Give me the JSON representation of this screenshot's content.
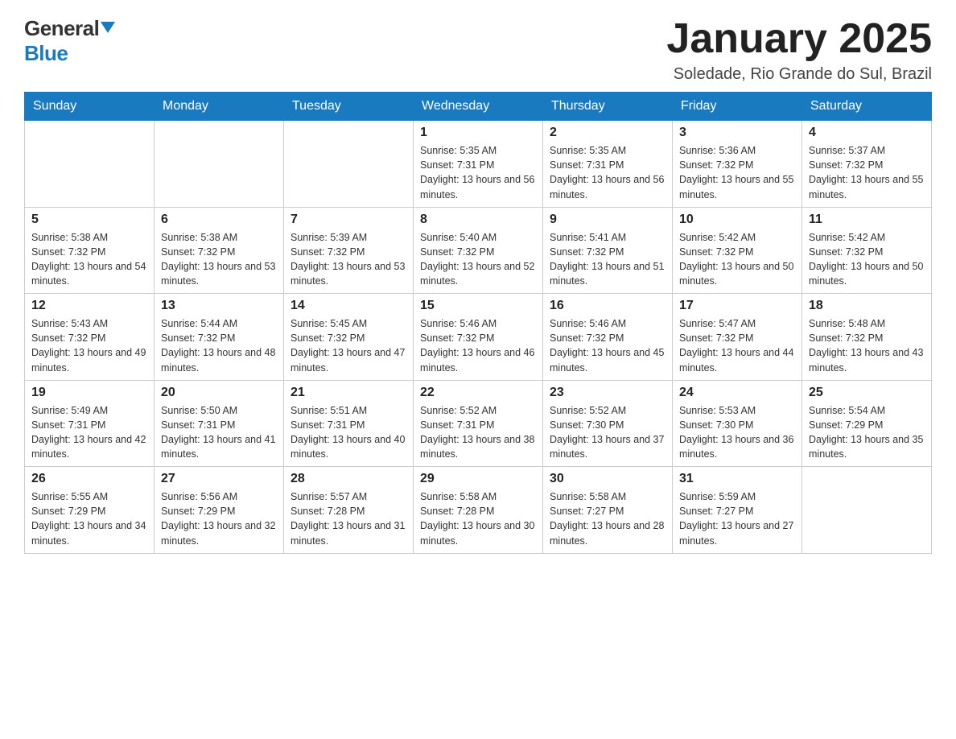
{
  "header": {
    "logo_general": "General",
    "logo_blue": "Blue",
    "month_title": "January 2025",
    "location": "Soledade, Rio Grande do Sul, Brazil"
  },
  "days_of_week": [
    "Sunday",
    "Monday",
    "Tuesday",
    "Wednesday",
    "Thursday",
    "Friday",
    "Saturday"
  ],
  "weeks": [
    [
      {
        "day": "",
        "info": ""
      },
      {
        "day": "",
        "info": ""
      },
      {
        "day": "",
        "info": ""
      },
      {
        "day": "1",
        "info": "Sunrise: 5:35 AM\nSunset: 7:31 PM\nDaylight: 13 hours and 56 minutes."
      },
      {
        "day": "2",
        "info": "Sunrise: 5:35 AM\nSunset: 7:31 PM\nDaylight: 13 hours and 56 minutes."
      },
      {
        "day": "3",
        "info": "Sunrise: 5:36 AM\nSunset: 7:32 PM\nDaylight: 13 hours and 55 minutes."
      },
      {
        "day": "4",
        "info": "Sunrise: 5:37 AM\nSunset: 7:32 PM\nDaylight: 13 hours and 55 minutes."
      }
    ],
    [
      {
        "day": "5",
        "info": "Sunrise: 5:38 AM\nSunset: 7:32 PM\nDaylight: 13 hours and 54 minutes."
      },
      {
        "day": "6",
        "info": "Sunrise: 5:38 AM\nSunset: 7:32 PM\nDaylight: 13 hours and 53 minutes."
      },
      {
        "day": "7",
        "info": "Sunrise: 5:39 AM\nSunset: 7:32 PM\nDaylight: 13 hours and 53 minutes."
      },
      {
        "day": "8",
        "info": "Sunrise: 5:40 AM\nSunset: 7:32 PM\nDaylight: 13 hours and 52 minutes."
      },
      {
        "day": "9",
        "info": "Sunrise: 5:41 AM\nSunset: 7:32 PM\nDaylight: 13 hours and 51 minutes."
      },
      {
        "day": "10",
        "info": "Sunrise: 5:42 AM\nSunset: 7:32 PM\nDaylight: 13 hours and 50 minutes."
      },
      {
        "day": "11",
        "info": "Sunrise: 5:42 AM\nSunset: 7:32 PM\nDaylight: 13 hours and 50 minutes."
      }
    ],
    [
      {
        "day": "12",
        "info": "Sunrise: 5:43 AM\nSunset: 7:32 PM\nDaylight: 13 hours and 49 minutes."
      },
      {
        "day": "13",
        "info": "Sunrise: 5:44 AM\nSunset: 7:32 PM\nDaylight: 13 hours and 48 minutes."
      },
      {
        "day": "14",
        "info": "Sunrise: 5:45 AM\nSunset: 7:32 PM\nDaylight: 13 hours and 47 minutes."
      },
      {
        "day": "15",
        "info": "Sunrise: 5:46 AM\nSunset: 7:32 PM\nDaylight: 13 hours and 46 minutes."
      },
      {
        "day": "16",
        "info": "Sunrise: 5:46 AM\nSunset: 7:32 PM\nDaylight: 13 hours and 45 minutes."
      },
      {
        "day": "17",
        "info": "Sunrise: 5:47 AM\nSunset: 7:32 PM\nDaylight: 13 hours and 44 minutes."
      },
      {
        "day": "18",
        "info": "Sunrise: 5:48 AM\nSunset: 7:32 PM\nDaylight: 13 hours and 43 minutes."
      }
    ],
    [
      {
        "day": "19",
        "info": "Sunrise: 5:49 AM\nSunset: 7:31 PM\nDaylight: 13 hours and 42 minutes."
      },
      {
        "day": "20",
        "info": "Sunrise: 5:50 AM\nSunset: 7:31 PM\nDaylight: 13 hours and 41 minutes."
      },
      {
        "day": "21",
        "info": "Sunrise: 5:51 AM\nSunset: 7:31 PM\nDaylight: 13 hours and 40 minutes."
      },
      {
        "day": "22",
        "info": "Sunrise: 5:52 AM\nSunset: 7:31 PM\nDaylight: 13 hours and 38 minutes."
      },
      {
        "day": "23",
        "info": "Sunrise: 5:52 AM\nSunset: 7:30 PM\nDaylight: 13 hours and 37 minutes."
      },
      {
        "day": "24",
        "info": "Sunrise: 5:53 AM\nSunset: 7:30 PM\nDaylight: 13 hours and 36 minutes."
      },
      {
        "day": "25",
        "info": "Sunrise: 5:54 AM\nSunset: 7:29 PM\nDaylight: 13 hours and 35 minutes."
      }
    ],
    [
      {
        "day": "26",
        "info": "Sunrise: 5:55 AM\nSunset: 7:29 PM\nDaylight: 13 hours and 34 minutes."
      },
      {
        "day": "27",
        "info": "Sunrise: 5:56 AM\nSunset: 7:29 PM\nDaylight: 13 hours and 32 minutes."
      },
      {
        "day": "28",
        "info": "Sunrise: 5:57 AM\nSunset: 7:28 PM\nDaylight: 13 hours and 31 minutes."
      },
      {
        "day": "29",
        "info": "Sunrise: 5:58 AM\nSunset: 7:28 PM\nDaylight: 13 hours and 30 minutes."
      },
      {
        "day": "30",
        "info": "Sunrise: 5:58 AM\nSunset: 7:27 PM\nDaylight: 13 hours and 28 minutes."
      },
      {
        "day": "31",
        "info": "Sunrise: 5:59 AM\nSunset: 7:27 PM\nDaylight: 13 hours and 27 minutes."
      },
      {
        "day": "",
        "info": ""
      }
    ]
  ]
}
